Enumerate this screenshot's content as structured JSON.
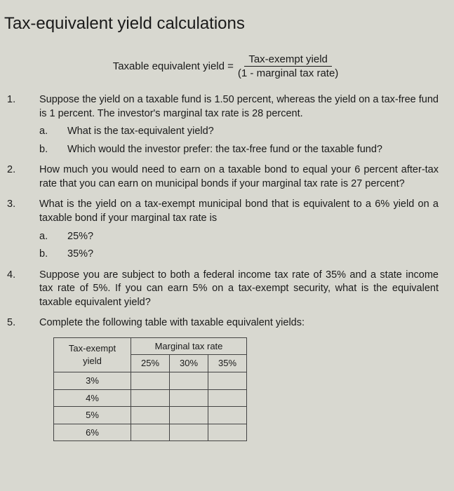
{
  "title": "Tax-equivalent yield calculations",
  "formula": {
    "lhs": "Taxable equivalent yield =",
    "numerator": "Tax-exempt yield",
    "denominator": "(1 - marginal tax rate)"
  },
  "questions": [
    {
      "num": "1.",
      "text": "Suppose the yield on a taxable fund is 1.50 percent, whereas the yield on a tax-free fund is 1 percent. The investor's marginal tax rate is 28 percent.",
      "subs": [
        {
          "letter": "a.",
          "text": "What is the tax-equivalent yield?"
        },
        {
          "letter": "b.",
          "text": "Which would the investor prefer: the tax-free fund or the taxable fund?"
        }
      ]
    },
    {
      "num": "2.",
      "text": "How much you would need to earn on a taxable bond to equal your 6 percent after-tax rate that you can earn on municipal bonds if your marginal tax rate is 27 percent?",
      "subs": []
    },
    {
      "num": "3.",
      "text": "What is the yield on a tax-exempt municipal bond that is equivalent to a 6% yield on a taxable bond if your marginal tax rate is",
      "subs": [
        {
          "letter": "a.",
          "text": "25%?"
        },
        {
          "letter": "b.",
          "text": "35%?"
        }
      ]
    },
    {
      "num": "4.",
      "text": "Suppose you are subject to both a federal income tax rate of 35% and a state income tax rate of 5%. If you can earn 5% on a tax-exempt security, what is the equivalent taxable equivalent yield?",
      "subs": []
    },
    {
      "num": "5.",
      "text": "Complete the following table with taxable equivalent yields:",
      "subs": []
    }
  ],
  "table": {
    "header_left": "Tax-exempt yield",
    "header_right": "Marginal tax rate",
    "rate_cols": [
      "25%",
      "30%",
      "35%"
    ],
    "yield_rows": [
      "3%",
      "4%",
      "5%",
      "6%"
    ]
  }
}
